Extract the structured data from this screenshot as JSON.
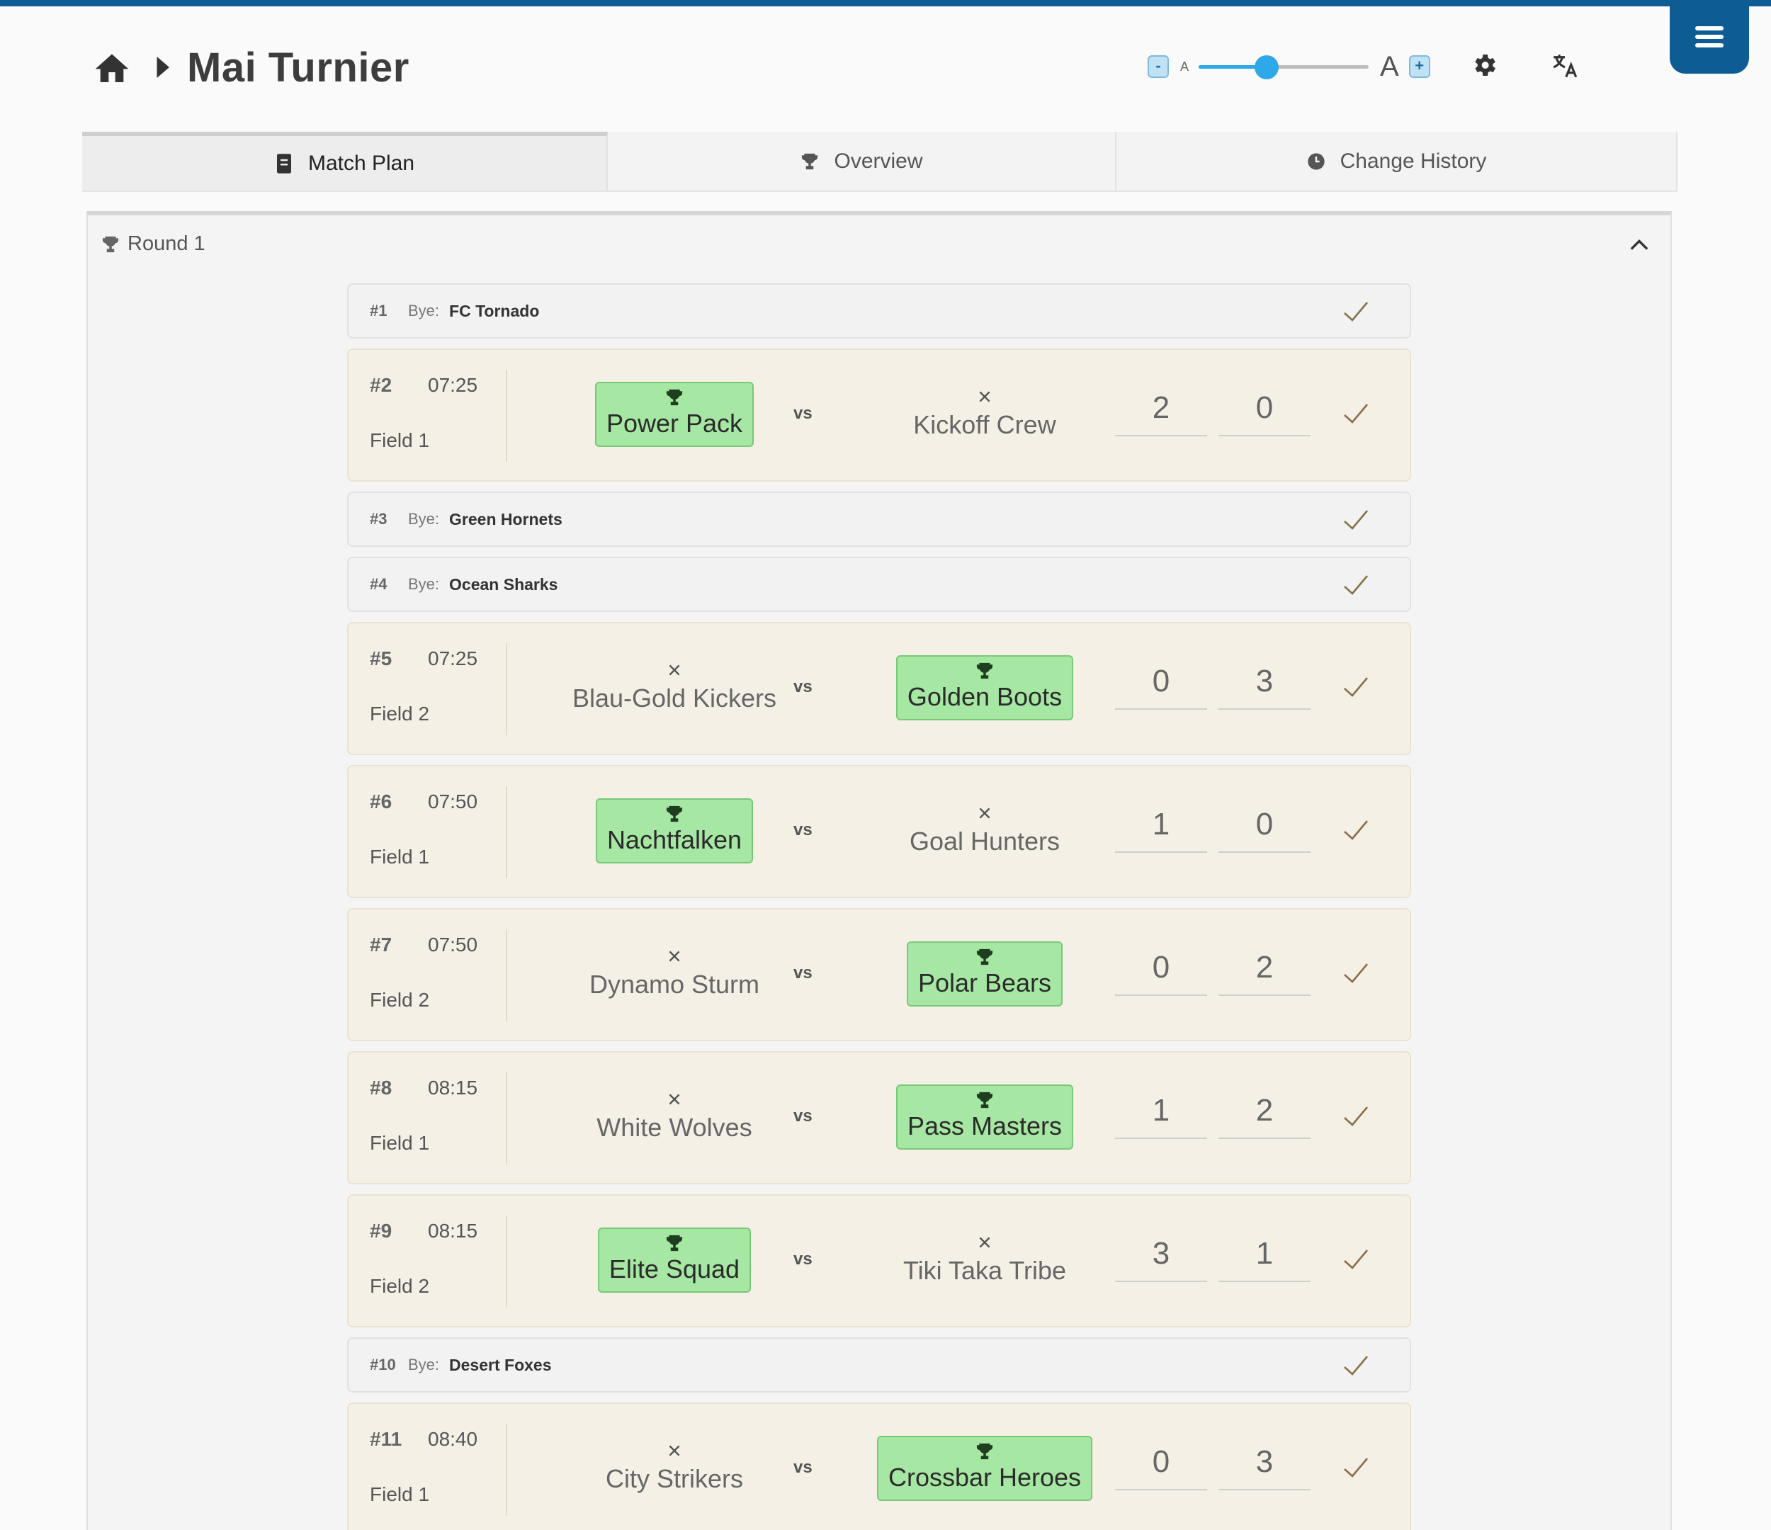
{
  "header": {
    "title": "Mai Turnier"
  },
  "font_control": {
    "decrease": "-",
    "increase": "+",
    "small_a": "A",
    "big_a": "A",
    "level": 0.4
  },
  "tabs": [
    {
      "label": "Match Plan",
      "icon": "document-icon",
      "active": true
    },
    {
      "label": "Overview",
      "icon": "trophy-icon",
      "active": false
    },
    {
      "label": "Change History",
      "icon": "clock-icon",
      "active": false
    }
  ],
  "round": {
    "label": "Round 1"
  },
  "bye_label": "Bye:",
  "vs_label": "vs",
  "colors": {
    "brand": "#0d5d94",
    "winner": "#a6e7a3",
    "match_bg": "#f5f0e6",
    "accent": "#2ea8e8"
  },
  "matches": [
    {
      "type": "bye",
      "number": "#1",
      "team": "FC Tornado"
    },
    {
      "type": "match",
      "number": "#2",
      "time": "07:25",
      "field": "Field 1",
      "home": "Power Pack",
      "away": "Kickoff Crew",
      "home_score": "2",
      "away_score": "0",
      "winner": "home"
    },
    {
      "type": "bye",
      "number": "#3",
      "team": "Green Hornets"
    },
    {
      "type": "bye",
      "number": "#4",
      "team": "Ocean Sharks"
    },
    {
      "type": "match",
      "number": "#5",
      "time": "07:25",
      "field": "Field 2",
      "home": "Blau-Gold Kickers",
      "away": "Golden Boots",
      "home_score": "0",
      "away_score": "3",
      "winner": "away"
    },
    {
      "type": "match",
      "number": "#6",
      "time": "07:50",
      "field": "Field 1",
      "home": "Nachtfalken",
      "away": "Goal Hunters",
      "home_score": "1",
      "away_score": "0",
      "winner": "home"
    },
    {
      "type": "match",
      "number": "#7",
      "time": "07:50",
      "field": "Field 2",
      "home": "Dynamo Sturm",
      "away": "Polar Bears",
      "home_score": "0",
      "away_score": "2",
      "winner": "away"
    },
    {
      "type": "match",
      "number": "#8",
      "time": "08:15",
      "field": "Field 1",
      "home": "White Wolves",
      "away": "Pass Masters",
      "home_score": "1",
      "away_score": "2",
      "winner": "away"
    },
    {
      "type": "match",
      "number": "#9",
      "time": "08:15",
      "field": "Field 2",
      "home": "Elite Squad",
      "away": "Tiki Taka Tribe",
      "home_score": "3",
      "away_score": "1",
      "winner": "home"
    },
    {
      "type": "bye",
      "number": "#10",
      "team": "Desert Foxes"
    },
    {
      "type": "match",
      "number": "#11",
      "time": "08:40",
      "field": "Field 1",
      "home": "City Strikers",
      "away": "Crossbar Heroes",
      "home_score": "0",
      "away_score": "3",
      "winner": "away"
    }
  ]
}
